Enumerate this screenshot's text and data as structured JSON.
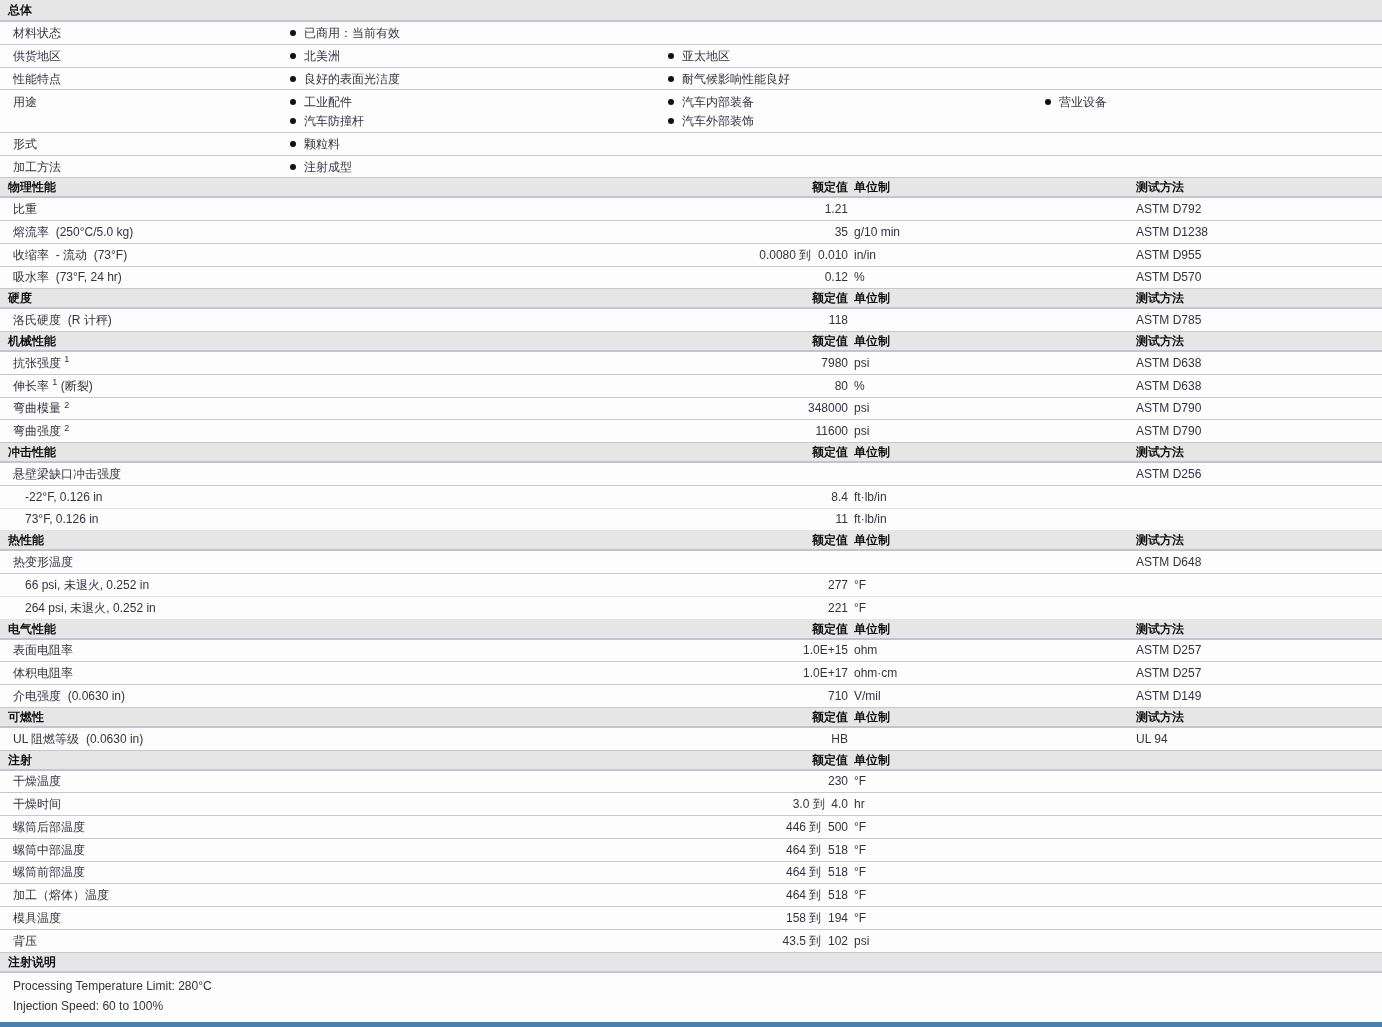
{
  "overview": {
    "title": "总体",
    "rows": [
      {
        "label": "材料状态",
        "items": [
          "已商用：当前有效"
        ]
      },
      {
        "label": "供货地区",
        "items": [
          "北美洲",
          "亚太地区"
        ]
      },
      {
        "label": "性能特点",
        "items": [
          "良好的表面光洁度",
          "耐气候影响性能良好"
        ]
      },
      {
        "label": "用途",
        "items": [
          "工业配件",
          "汽车内部装备",
          "营业设备",
          "汽车防撞杆",
          "汽车外部装饰"
        ]
      },
      {
        "label": "形式",
        "items": [
          "颗粒料"
        ]
      },
      {
        "label": "加工方法",
        "items": [
          "注射成型"
        ]
      }
    ]
  },
  "sections": [
    {
      "title": "物理性能",
      "value_header": "额定值",
      "unit_header": "单位制",
      "method_header": "测试方法",
      "rows": [
        {
          "kind": "main",
          "label": "比重",
          "value": "1.21",
          "method": "ASTM D792"
        },
        {
          "kind": "main",
          "label": "熔流率  (250°C/5.0 kg)",
          "value": "35",
          "unit": "g/10 min",
          "method": "ASTM D1238"
        },
        {
          "kind": "main",
          "label": "收缩率  - 流动  (73°F)",
          "value": "0.0080 到  0.010",
          "unit": "in/in",
          "method": "ASTM D955"
        },
        {
          "kind": "main",
          "label": "吸水率  (73°F, 24 hr)",
          "value": "0.12",
          "unit": "%",
          "method": "ASTM D570"
        }
      ]
    },
    {
      "title": "硬度",
      "value_header": "额定值",
      "unit_header": "单位制",
      "method_header": "测试方法",
      "rows": [
        {
          "kind": "main",
          "label": "洛氏硬度  (R 计秤)",
          "value": "118",
          "method": "ASTM D785"
        }
      ]
    },
    {
      "title": "机械性能",
      "value_header": "额定值",
      "unit_header": "单位制",
      "method_header": "测试方法",
      "rows": [
        {
          "kind": "main",
          "label": "抗张强度 $^{1}$",
          "value": "7980",
          "unit": "psi",
          "method": "ASTM D638"
        },
        {
          "kind": "main",
          "label": "伸长率 $^{1}$ (断裂)",
          "value": "80",
          "unit": "%",
          "method": "ASTM D638"
        },
        {
          "kind": "main",
          "label": "弯曲模量 $^{2}$",
          "value": "348000",
          "unit": "psi",
          "method": "ASTM D790"
        },
        {
          "kind": "main",
          "label": "弯曲强度 $^{2}$",
          "value": "11600",
          "unit": "psi",
          "method": "ASTM D790"
        }
      ]
    },
    {
      "title": "冲击性能",
      "value_header": "额定值",
      "unit_header": "单位制",
      "method_header": "测试方法",
      "rows": [
        {
          "kind": "main",
          "label": "悬壁梁缺口冲击强度",
          "method": "ASTM D256"
        },
        {
          "kind": "sub",
          "label": "-22°F, 0.126 in",
          "value": "8.4",
          "unit": "ft·lb/in"
        },
        {
          "kind": "sub",
          "label": "73°F, 0.126 in",
          "value": "11",
          "unit": "ft·lb/in"
        }
      ]
    },
    {
      "title": "热性能",
      "value_header": "额定值",
      "unit_header": "单位制",
      "method_header": "测试方法",
      "rows": [
        {
          "kind": "main",
          "label": "热变形温度",
          "method": "ASTM D648"
        },
        {
          "kind": "sub",
          "label": "66 psi, 未退火, 0.252 in",
          "value": "277",
          "unit": "°F"
        },
        {
          "kind": "sub",
          "label": "264 psi, 未退火, 0.252 in",
          "value": "221",
          "unit": "°F"
        }
      ]
    },
    {
      "title": "电气性能",
      "value_header": "额定值",
      "unit_header": "单位制",
      "method_header": "测试方法",
      "rows": [
        {
          "kind": "main",
          "label": "表面电阻率",
          "value": "1.0E+15",
          "unit": "ohm",
          "method": "ASTM D257"
        },
        {
          "kind": "main",
          "label": "体积电阻率",
          "value": "1.0E+17",
          "unit": "ohm·cm",
          "method": "ASTM D257"
        },
        {
          "kind": "main",
          "label": "介电强度  (0.0630 in)",
          "value": "710",
          "unit": "V/mil",
          "method": "ASTM D149"
        }
      ]
    },
    {
      "title": "可燃性",
      "value_header": "额定值",
      "unit_header": "单位制",
      "method_header": "测试方法",
      "rows": [
        {
          "kind": "main",
          "label": "UL 阻燃等级  (0.0630 in)",
          "value": "HB",
          "method": "UL 94"
        }
      ]
    },
    {
      "title": "注射",
      "value_header": "额定值",
      "unit_header": "单位制",
      "rows": [
        {
          "kind": "main",
          "label": "干燥温度",
          "value": "230",
          "unit": "°F"
        },
        {
          "kind": "main",
          "label": "干燥时间",
          "value": "3.0 到  4.0",
          "unit": "hr"
        },
        {
          "kind": "main",
          "label": "螺筒后部温度",
          "value": "446 到  500",
          "unit": "°F"
        },
        {
          "kind": "main",
          "label": "螺筒中部温度",
          "value": "464 到  518",
          "unit": "°F"
        },
        {
          "kind": "main",
          "label": "螺筒前部温度",
          "value": "464 到  518",
          "unit": "°F"
        },
        {
          "kind": "main",
          "label": "加工（熔体）温度",
          "value": "464 到  518",
          "unit": "°F"
        },
        {
          "kind": "main",
          "label": "模具温度",
          "value": "158 到  194",
          "unit": "°F"
        },
        {
          "kind": "main",
          "label": "背压",
          "value": "43.5 到  102",
          "unit": "psi"
        }
      ]
    }
  ],
  "notes": {
    "title": "注射说明",
    "lines": [
      "Processing Temperature Limit: 280°C",
      "Injection Speed: 60 to 100%"
    ]
  }
}
